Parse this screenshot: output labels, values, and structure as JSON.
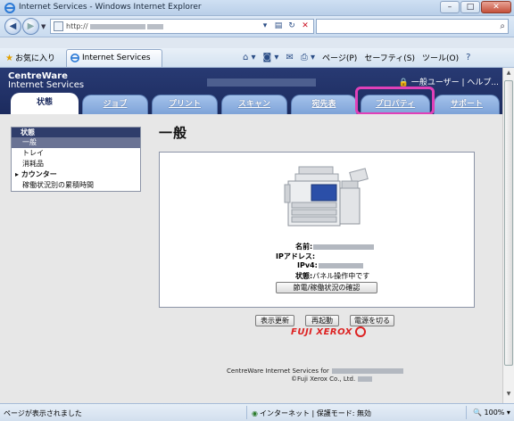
{
  "window": {
    "title": "Internet Services - Windows Internet Explorer",
    "minimize": "–",
    "maximize": "□",
    "close": "✕"
  },
  "address": {
    "url_prefix": "http://",
    "back_icon": "◀",
    "forward_icon": "▶",
    "search_icon": "⌕"
  },
  "command_bar": {
    "favorites": "お気に入り",
    "tab_title": "Internet Services",
    "page_menu": "ページ(P)",
    "safety_menu": "セーフティ(S)",
    "tools_menu": "ツール(O)",
    "help_icon": "?"
  },
  "banner": {
    "brand_line1": "CentreWare",
    "brand_line2": "Internet Services",
    "user_text": "一般ユーザー | ヘルプ..."
  },
  "tabs": [
    {
      "label": "状態"
    },
    {
      "label": "ジョブ"
    },
    {
      "label": "プリント"
    },
    {
      "label": "スキャン"
    },
    {
      "label": "宛先表"
    },
    {
      "label": "プロパティ"
    },
    {
      "label": "サポート"
    }
  ],
  "sidebar": {
    "header": "状態",
    "items": [
      {
        "label": "一般"
      },
      {
        "label": "トレイ"
      },
      {
        "label": "消耗品"
      },
      {
        "label": "▸ カウンター"
      },
      {
        "label": "稼働状況別の累積時間"
      }
    ]
  },
  "main": {
    "heading": "一般",
    "name_label": "名前:",
    "ip_label": "IPアドレス:",
    "ipv4_label": "IPv4:",
    "status_label": "状態:",
    "status_value": "パネル操作中です",
    "power_check_button": "節電/稼働状況の確認",
    "refresh_button": "表示更新",
    "reboot_button": "再起動",
    "power_off_button": "電源を切る"
  },
  "footer": {
    "logo_text": "FUJI XEROX",
    "line1": "CentreWare Internet Services for",
    "line2": "©Fuji Xerox Co., Ltd."
  },
  "statusbar": {
    "message": "ページが表示されました",
    "zone": "インターネット | 保護モード: 無効",
    "zoom": "100%"
  },
  "colors": {
    "banner": "#1c2b5e",
    "tab": "#7ea3d8",
    "highlight": "#e040b8",
    "logo": "#dd2222"
  }
}
